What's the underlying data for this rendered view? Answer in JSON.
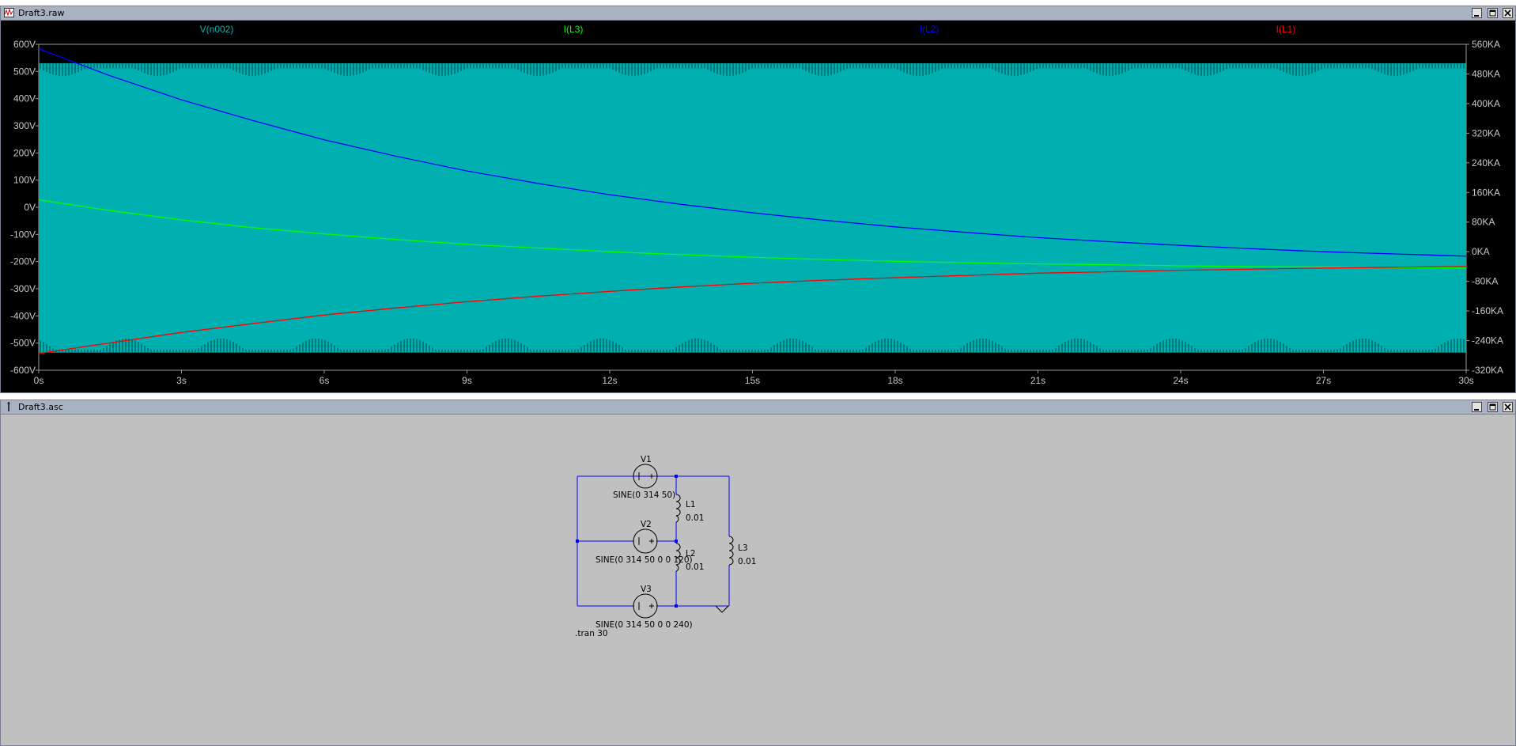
{
  "raw_window": {
    "title": "Draft3.raw",
    "legend": [
      {
        "label": "V(n002)",
        "color": "#00b4b4"
      },
      {
        "label": "I(L3)",
        "color": "#00ff00"
      },
      {
        "label": "I(L2)",
        "color": "#0000ff"
      },
      {
        "label": "I(L1)",
        "color": "#ff0000"
      }
    ]
  },
  "asc_window": {
    "title": "Draft3.asc"
  },
  "colors": {
    "plot_bg": "#00b0b0",
    "axis_text": "#c8c8c8",
    "wire": "#0000ff",
    "schematic_bg": "#c0c0c0"
  },
  "chart_data": {
    "type": "line",
    "x": [
      0,
      1.5,
      3,
      4.5,
      6,
      7.5,
      9,
      10.5,
      12,
      13.5,
      15,
      16.5,
      18,
      19.5,
      21,
      22.5,
      24,
      25.5,
      27,
      28.5,
      30
    ],
    "x_ticks": [
      "0s",
      "3s",
      "6s",
      "9s",
      "12s",
      "15s",
      "18s",
      "21s",
      "24s",
      "27s",
      "30s"
    ],
    "xlim": [
      0,
      30
    ],
    "y_left_ticks": [
      "600V",
      "500V",
      "400V",
      "300V",
      "200V",
      "100V",
      "0V",
      "-100V",
      "-200V",
      "-300V",
      "-400V",
      "-500V",
      "-600V"
    ],
    "ylim_left": [
      -600,
      600
    ],
    "y_right_ticks": [
      "560KA",
      "480KA",
      "400KA",
      "320KA",
      "240KA",
      "160KA",
      "80KA",
      "0KA",
      "-80KA",
      "-160KA",
      "-240KA",
      "-320KA"
    ],
    "ylim_right": [
      -320,
      560
    ],
    "grid": false,
    "band": {
      "name": "V(n002)",
      "axis": "left",
      "amplitude": 510,
      "peak_max": 530,
      "peak_min": -535,
      "color": "#00b0b0"
    },
    "series": [
      {
        "name": "I(L3)",
        "axis": "right",
        "color": "#00ff00",
        "values": [
          140,
          111,
          86,
          65,
          48,
          33,
          20,
          10,
          0,
          -8,
          -15,
          -21,
          -26,
          -30,
          -33,
          -35,
          -38,
          -40,
          -41,
          -43,
          -44
        ]
      },
      {
        "name": "I(L2)",
        "axis": "right",
        "color": "#0000ff",
        "values": [
          548,
          475,
          410,
          354,
          302,
          258,
          218,
          184,
          154,
          128,
          105,
          85,
          67,
          52,
          38,
          27,
          17,
          8,
          0,
          -6,
          -12
        ]
      },
      {
        "name": "I(L1)",
        "axis": "right",
        "color": "#ff0000",
        "values": [
          -275,
          -246,
          -218,
          -194,
          -171,
          -152,
          -135,
          -120,
          -107,
          -95,
          -85,
          -77,
          -70,
          -64,
          -58,
          -54,
          -50,
          -47,
          -44,
          -42,
          -40
        ]
      }
    ]
  },
  "schematic": {
    "v1_name": "V1",
    "v1_value": "SINE(0 314 50)",
    "v2_name": "V2",
    "v2_value": "SINE(0 314 50 0 0 120)",
    "v3_name": "V3",
    "v3_value": "SINE(0 314 50 0 0 240)",
    "l1_name": "L1",
    "l1_value": "0.01",
    "l2_name": "L2",
    "l2_value": "0.01",
    "l3_name": "L3",
    "l3_value": "0.01",
    "directive": ".tran 30"
  }
}
